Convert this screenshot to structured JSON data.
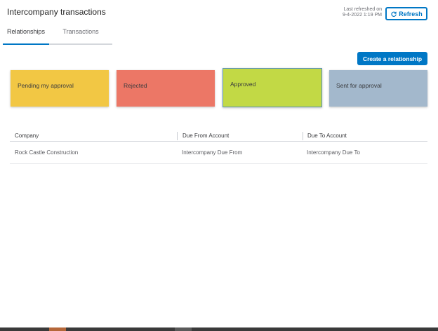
{
  "header": {
    "title": "Intercompany transactions",
    "last_refreshed_label": "Last refreshed on",
    "last_refreshed_value": "9-4-2022 1:19 PM",
    "refresh_label": "Refresh"
  },
  "tabs": [
    {
      "label": "Relationships",
      "active": true
    },
    {
      "label": "Transactions",
      "active": false
    }
  ],
  "create_button_label": "Create a relationship",
  "status_cards": [
    {
      "label": "Pending my approval",
      "color": "#f2c744"
    },
    {
      "label": "Rejected",
      "color": "#ec7766"
    },
    {
      "label": "Approved",
      "color": "#c2d945"
    },
    {
      "label": "Sent for approval",
      "color": "#a3b8cc"
    }
  ],
  "table": {
    "columns": [
      "Company",
      "Due From Account",
      "Due To Account"
    ],
    "rows": [
      [
        "Rock Castle Construction",
        "Intercompany Due From",
        "Intercompany Due To"
      ]
    ]
  },
  "colors": {
    "accent": "#0077c5"
  }
}
